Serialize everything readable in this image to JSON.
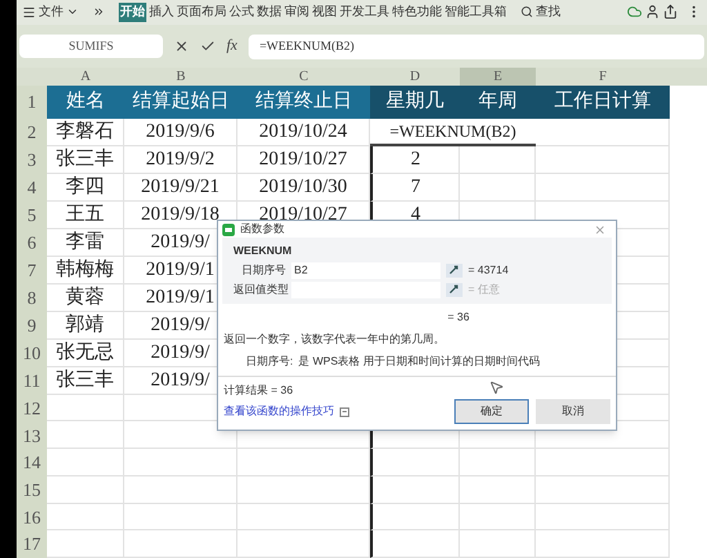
{
  "menu": {
    "file": "文件",
    "items": [
      {
        "label": "开始",
        "selected": true
      },
      {
        "label": "插入",
        "selected": false
      },
      {
        "label": "页面布局",
        "selected": false
      },
      {
        "label": "公式",
        "selected": false
      },
      {
        "label": "数据",
        "selected": false
      },
      {
        "label": "审阅",
        "selected": false
      },
      {
        "label": "视图",
        "selected": false
      },
      {
        "label": "开发工具",
        "selected": false
      },
      {
        "label": "特色功能",
        "selected": false
      },
      {
        "label": "智能工具箱",
        "selected": false
      }
    ],
    "search": "查找"
  },
  "formula_bar": {
    "name_box": "SUMIFS",
    "fx": "fx",
    "formula": "=WEEKNUM(B2)"
  },
  "columns": [
    {
      "label": "A",
      "selected": false
    },
    {
      "label": "B",
      "selected": false
    },
    {
      "label": "C",
      "selected": false
    },
    {
      "label": "D",
      "selected": false
    },
    {
      "label": "E",
      "selected": true
    },
    {
      "label": "F",
      "selected": false
    }
  ],
  "rows": [
    {
      "number": "1",
      "kind": "header",
      "cells": [
        "姓名",
        "结算起始日",
        "结算终止日",
        "星期几",
        "年周",
        "工作日计算"
      ]
    },
    {
      "number": "2",
      "kind": "data",
      "cells": [
        "李磐石",
        "2019/9/6",
        "2019/10/24"
      ],
      "editing_formula": "=WEEKNUM(B2)"
    },
    {
      "number": "3",
      "kind": "data",
      "cells": [
        "张三丰",
        "2019/9/2",
        "2019/10/27",
        "2"
      ]
    },
    {
      "number": "4",
      "kind": "data",
      "cells": [
        "李四",
        "2019/9/21",
        "2019/10/30",
        "7"
      ]
    },
    {
      "number": "5",
      "kind": "data",
      "cells": [
        "王五",
        "2019/9/18",
        "2019/10/27",
        "4"
      ]
    },
    {
      "number": "6",
      "kind": "data",
      "cells": [
        "李雷",
        "2019/9/"
      ]
    },
    {
      "number": "7",
      "kind": "data",
      "cells": [
        "韩梅梅",
        "2019/9/1"
      ]
    },
    {
      "number": "8",
      "kind": "data",
      "cells": [
        "黄蓉",
        "2019/9/1"
      ]
    },
    {
      "number": "9",
      "kind": "data",
      "cells": [
        "郭靖",
        "2019/9/"
      ]
    },
    {
      "number": "10",
      "kind": "data",
      "cells": [
        "张无忌",
        "2019/9/"
      ]
    },
    {
      "number": "11",
      "kind": "data",
      "cells": [
        "张三丰",
        "2019/9/"
      ]
    },
    {
      "number": "12",
      "kind": "data",
      "cells": []
    },
    {
      "number": "13",
      "kind": "data",
      "cells": []
    },
    {
      "number": "14",
      "kind": "data",
      "cells": []
    },
    {
      "number": "15",
      "kind": "data",
      "cells": []
    },
    {
      "number": "16",
      "kind": "data",
      "cells": []
    },
    {
      "number": "17",
      "kind": "data",
      "cells": []
    }
  ],
  "dialog": {
    "title": "函数参数",
    "function": "WEEKNUM",
    "arguments": [
      {
        "label": "日期序号",
        "value": "B2",
        "result": "= 43714",
        "placeholder_result": false
      },
      {
        "label": "返回值类型",
        "result": "= 任意",
        "placeholder_result": true
      }
    ],
    "result": "= 36",
    "description": "返回一个数字，该数字代表一年中的第几周。",
    "argument_help_label": "日期序号:",
    "argument_help": "是 WPS表格 用于日期和时间计算的日期时间代码",
    "computed": "计算结果 = 36",
    "link": "查看该函数的操作技巧",
    "buttons": [
      {
        "label": "确定",
        "selected": true
      },
      {
        "label": "取消",
        "selected": false
      }
    ]
  }
}
